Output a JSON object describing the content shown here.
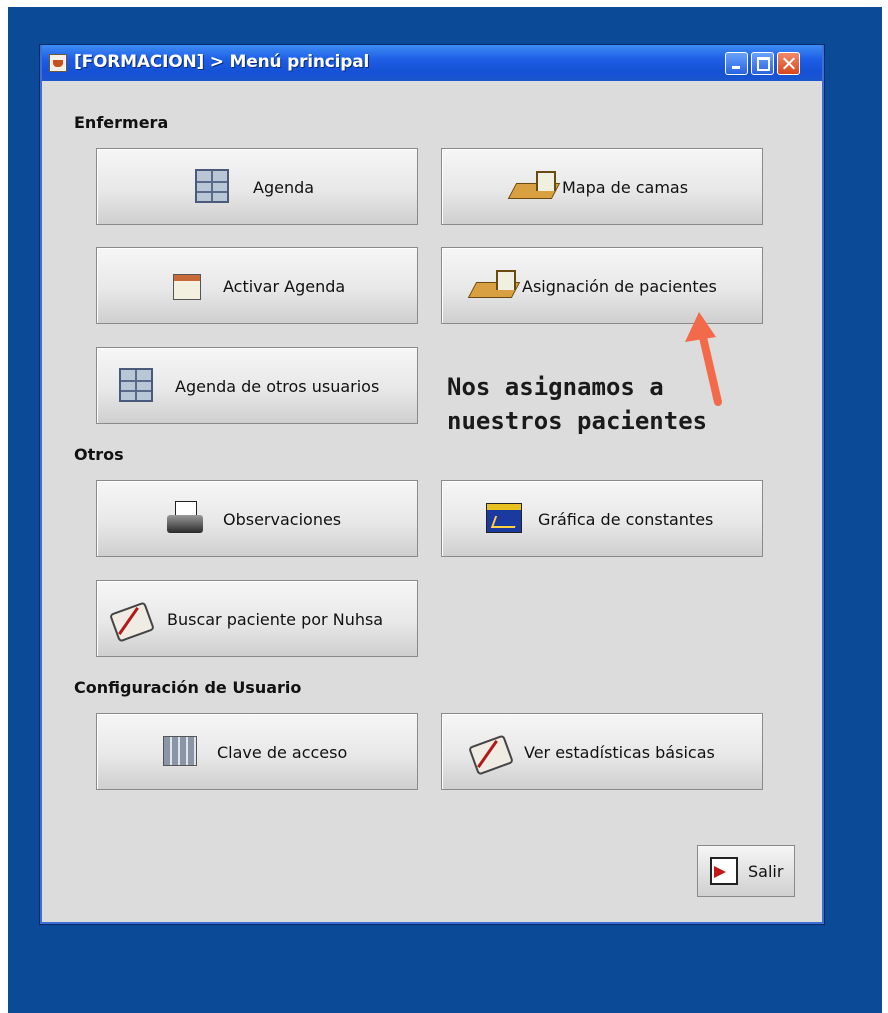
{
  "window": {
    "title": "[FORMACION] > Menú principal"
  },
  "sections": {
    "enfermera": "Enfermera",
    "otros": "Otros",
    "configuracion": "Configuración de Usuario"
  },
  "buttons": {
    "agenda": "Agenda",
    "mapa_camas": "Mapa de camas",
    "activar_agenda": "Activar Agenda",
    "asignacion_pacientes": "Asignación de pacientes",
    "agenda_otros": "Agenda de otros usuarios",
    "observaciones": "Observaciones",
    "grafica_constantes": "Gráfica de constantes",
    "buscar_paciente": "Buscar paciente por Nuhsa",
    "clave_acceso": "Clave de acceso",
    "ver_estadisticas": "Ver estadísticas básicas",
    "salir": "Salir"
  },
  "annotation": {
    "line1": "Nos asignamos a",
    "line2": "nuestros pacientes"
  },
  "colors": {
    "desktop": "#0a4a96",
    "titlebar": "#1e5ee6",
    "window_bg": "#dcdcdc",
    "arrow": "#f26a4a"
  },
  "icons": {
    "agenda": "agenda-grid-icon",
    "mapa_camas": "bed-icon",
    "activar_agenda": "calendar-icon",
    "asignacion_pacientes": "bed-icon",
    "agenda_otros": "agenda-grid-icon",
    "observaciones": "printer-icon",
    "grafica_constantes": "chart-icon",
    "buscar_paciente": "book-icon",
    "clave_acceso": "keypad-icon",
    "ver_estadisticas": "book-icon",
    "salir": "exit-door-icon"
  }
}
